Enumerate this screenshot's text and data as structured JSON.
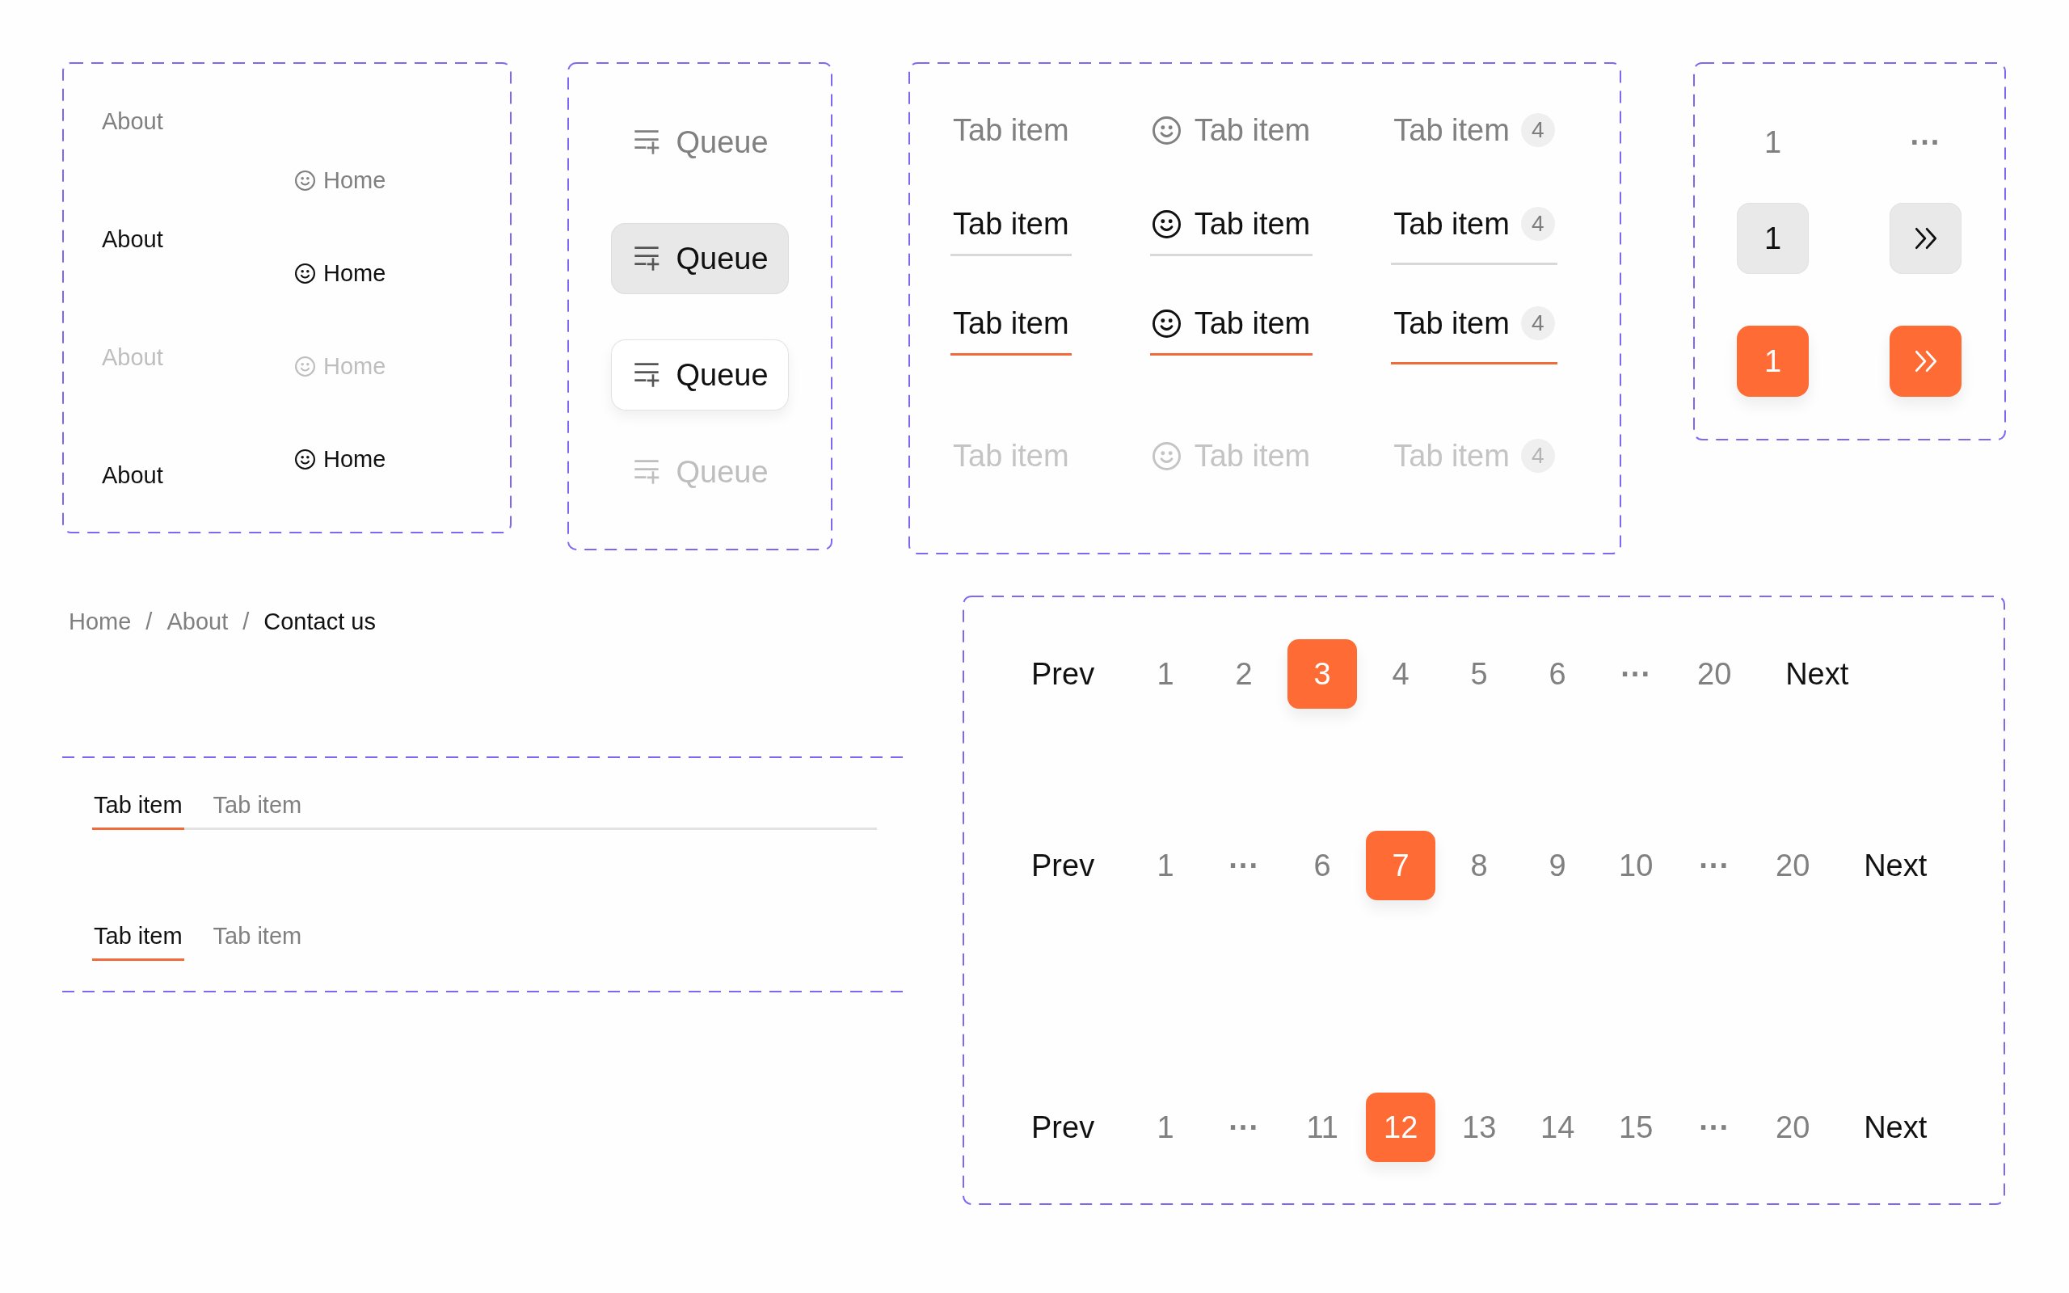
{
  "nav_links": {
    "text_links": [
      {
        "label": "About",
        "selected": false,
        "disabled": false
      },
      {
        "label": "About",
        "selected": true,
        "disabled": false
      },
      {
        "label": "About",
        "selected": false,
        "disabled": true
      },
      {
        "label": "About",
        "selected": true,
        "disabled": false
      }
    ],
    "icon_links": [
      {
        "label": "Home",
        "selected": false,
        "disabled": false
      },
      {
        "label": "Home",
        "selected": true,
        "disabled": false
      },
      {
        "label": "Home",
        "selected": false,
        "disabled": true
      },
      {
        "label": "Home",
        "selected": true,
        "disabled": false
      }
    ]
  },
  "queue_buttons": [
    {
      "label": "Queue",
      "kind": "ghost",
      "disabled": false
    },
    {
      "label": "Queue",
      "kind": "filled",
      "disabled": false
    },
    {
      "label": "Queue",
      "kind": "outlined",
      "disabled": false
    },
    {
      "label": "Queue",
      "kind": "ghost",
      "disabled": true
    }
  ],
  "tab_variants": [
    {
      "tabs": [
        {
          "kind": "plain",
          "label": "Tab item",
          "hovered": false,
          "selected": false,
          "disabled": false
        },
        {
          "kind": "icon",
          "label": "Tab item",
          "hovered": false,
          "selected": false,
          "disabled": false
        },
        {
          "kind": "badge",
          "label": "Tab item",
          "badge": "4",
          "hovered": false,
          "selected": false,
          "disabled": false
        }
      ]
    },
    {
      "tabs": [
        {
          "kind": "plain",
          "label": "Tab item",
          "hovered": true,
          "selected": false,
          "disabled": false
        },
        {
          "kind": "icon",
          "label": "Tab item",
          "hovered": true,
          "selected": false,
          "disabled": false
        },
        {
          "kind": "badge",
          "label": "Tab item",
          "badge": "4",
          "hovered": true,
          "selected": false,
          "disabled": false
        }
      ]
    },
    {
      "tabs": [
        {
          "kind": "plain",
          "label": "Tab item",
          "hovered": false,
          "selected": true,
          "disabled": false
        },
        {
          "kind": "icon",
          "label": "Tab item",
          "hovered": false,
          "selected": true,
          "disabled": false
        },
        {
          "kind": "badge",
          "label": "Tab item",
          "badge": "4",
          "hovered": false,
          "selected": true,
          "disabled": false
        }
      ]
    },
    {
      "tabs": [
        {
          "kind": "plain",
          "label": "Tab item",
          "hovered": false,
          "selected": false,
          "disabled": true
        },
        {
          "kind": "icon",
          "label": "Tab item",
          "hovered": false,
          "selected": false,
          "disabled": true
        },
        {
          "kind": "badge",
          "label": "Tab item",
          "badge": "4",
          "hovered": false,
          "selected": false,
          "disabled": true
        }
      ]
    }
  ],
  "page_item_variants": [
    {
      "items": [
        {
          "kind": "number",
          "label": "1",
          "hovered": false,
          "selected": false
        },
        {
          "kind": "ellipsis",
          "label": "···",
          "hovered": false,
          "selected": false
        }
      ]
    },
    {
      "items": [
        {
          "kind": "number",
          "label": "1",
          "hovered": true,
          "selected": false
        },
        {
          "kind": "jump",
          "hovered": true,
          "selected": false
        }
      ]
    },
    {
      "items": [
        {
          "kind": "number",
          "label": "1",
          "hovered": false,
          "selected": true
        },
        {
          "kind": "jump",
          "hovered": false,
          "selected": true
        }
      ]
    }
  ],
  "breadcrumbs": {
    "items": [
      {
        "label": "Home",
        "selected": false
      },
      {
        "label": "About",
        "selected": false
      },
      {
        "label": "Contact us",
        "selected": true
      }
    ],
    "separators": [
      "/",
      "/"
    ]
  },
  "tab_bars": [
    {
      "divider": true,
      "tabs": [
        {
          "label": "Tab item",
          "selected": true
        },
        {
          "label": "Tab item",
          "selected": false
        }
      ]
    },
    {
      "divider": false,
      "tabs": [
        {
          "label": "Tab item",
          "selected": true
        },
        {
          "label": "Tab item",
          "selected": false
        }
      ]
    }
  ],
  "pagination": [
    {
      "prev": "Prev",
      "next": "Next",
      "pages": [
        {
          "kind": "page",
          "label": "1",
          "selected": false
        },
        {
          "kind": "page",
          "label": "2",
          "selected": false
        },
        {
          "kind": "page",
          "label": "3",
          "selected": true
        },
        {
          "kind": "page",
          "label": "4",
          "selected": false
        },
        {
          "kind": "page",
          "label": "5",
          "selected": false
        },
        {
          "kind": "page",
          "label": "6",
          "selected": false
        },
        {
          "kind": "ellipsis",
          "label": "···",
          "selected": false
        },
        {
          "kind": "page",
          "label": "20",
          "selected": false
        }
      ]
    },
    {
      "prev": "Prev",
      "next": "Next",
      "pages": [
        {
          "kind": "page",
          "label": "1",
          "selected": false
        },
        {
          "kind": "ellipsis",
          "label": "···",
          "selected": false
        },
        {
          "kind": "page",
          "label": "6",
          "selected": false
        },
        {
          "kind": "page",
          "label": "7",
          "selected": true
        },
        {
          "kind": "page",
          "label": "8",
          "selected": false
        },
        {
          "kind": "page",
          "label": "9",
          "selected": false
        },
        {
          "kind": "page",
          "label": "10",
          "selected": false
        },
        {
          "kind": "ellipsis",
          "label": "···",
          "selected": false
        },
        {
          "kind": "page",
          "label": "20",
          "selected": false
        }
      ]
    },
    {
      "prev": "Prev",
      "next": "Next",
      "pages": [
        {
          "kind": "page",
          "label": "1",
          "selected": false
        },
        {
          "kind": "ellipsis",
          "label": "···",
          "selected": false
        },
        {
          "kind": "page",
          "label": "11",
          "selected": false
        },
        {
          "kind": "page",
          "label": "12",
          "selected": true
        },
        {
          "kind": "page",
          "label": "13",
          "selected": false
        },
        {
          "kind": "page",
          "label": "14",
          "selected": false
        },
        {
          "kind": "page",
          "label": "15",
          "selected": false
        },
        {
          "kind": "ellipsis",
          "label": "···",
          "selected": false
        },
        {
          "kind": "page",
          "label": "20",
          "selected": false
        }
      ]
    }
  ]
}
